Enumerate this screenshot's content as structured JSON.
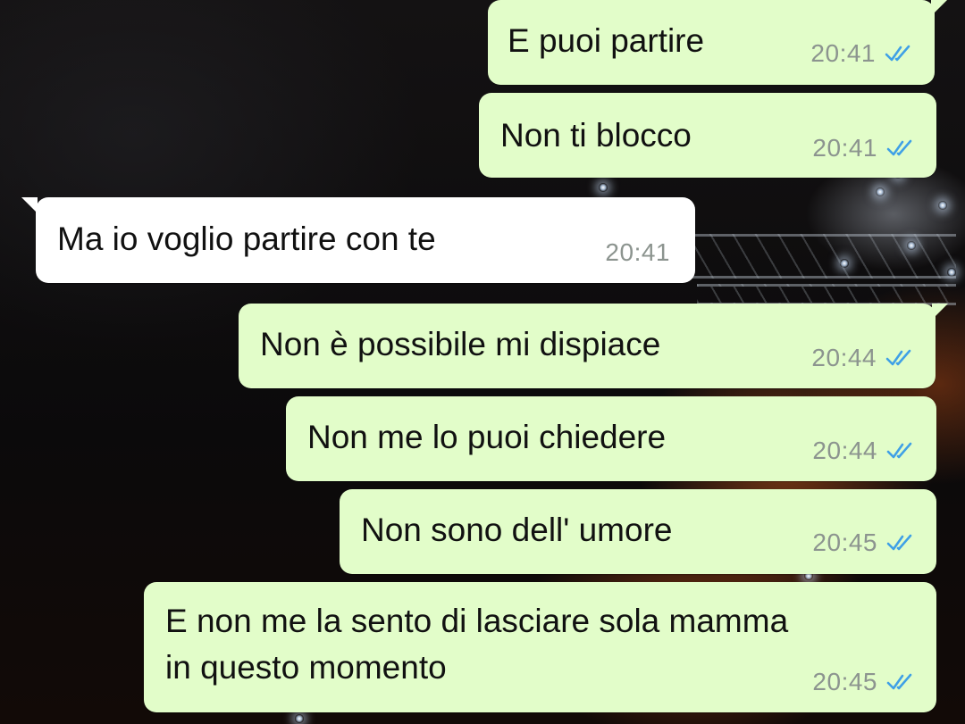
{
  "chat": {
    "messages": [
      {
        "direction": "out",
        "text": "E puoi partire",
        "time": "20:41",
        "status_icon": "double-check-icon",
        "status_color": "#3fa0e6"
      },
      {
        "direction": "out",
        "text": "Non ti blocco",
        "time": "20:41",
        "status_icon": "double-check-icon",
        "status_color": "#3fa0e6"
      },
      {
        "direction": "in",
        "text": "Ma io voglio partire con te",
        "time": "20:41"
      },
      {
        "direction": "out",
        "text": "Non è possibile mi dispiace",
        "time": "20:44",
        "status_icon": "double-check-icon",
        "status_color": "#3fa0e6"
      },
      {
        "direction": "out",
        "text": "Non me lo puoi chiedere",
        "time": "20:44",
        "status_icon": "double-check-icon",
        "status_color": "#3fa0e6"
      },
      {
        "direction": "out",
        "text": "Non sono dell' umore",
        "time": "20:45",
        "status_icon": "double-check-icon",
        "status_color": "#3fa0e6"
      },
      {
        "direction": "out",
        "text_lines": [
          "E non me la sento di lasciare sola mamma",
          "in questo momento"
        ],
        "time": "20:45",
        "status_icon": "double-check-icon",
        "status_color": "#3fa0e6"
      }
    ]
  },
  "theme": {
    "outgoing_bubble": "#e2fdc9",
    "incoming_bubble": "#ffffff",
    "time_color": "#8c948f",
    "read_check_color": "#3fa0e6"
  }
}
